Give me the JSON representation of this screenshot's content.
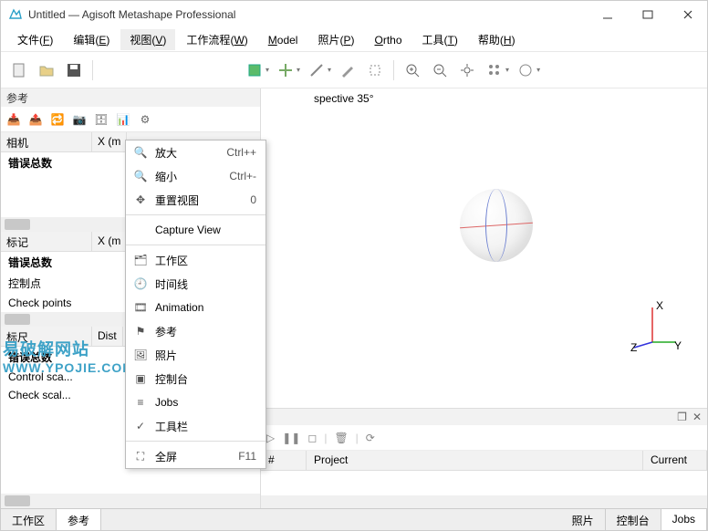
{
  "window": {
    "title": "Untitled — Agisoft Metashape Professional"
  },
  "menubar": {
    "items": [
      {
        "label": "文件",
        "accel": "F"
      },
      {
        "label": "编辑",
        "accel": "E"
      },
      {
        "label": "视图",
        "accel": "V"
      },
      {
        "label": "工作流程",
        "accel": "W"
      },
      {
        "label": "Model",
        "accel": ""
      },
      {
        "label": "照片",
        "accel": "P"
      },
      {
        "label": "Ortho",
        "accel": ""
      },
      {
        "label": "工具",
        "accel": "T"
      },
      {
        "label": "帮助",
        "accel": "H"
      }
    ]
  },
  "view_menu": {
    "items": [
      {
        "icon": "zoom-in-icon",
        "label": "放大",
        "shortcut": "Ctrl++"
      },
      {
        "icon": "zoom-out-icon",
        "label": "缩小",
        "shortcut": "Ctrl+-"
      },
      {
        "icon": "reset-view-icon",
        "label": "重置视图",
        "shortcut": "0"
      },
      {
        "sep": true
      },
      {
        "icon": "",
        "label": "Capture View",
        "shortcut": ""
      },
      {
        "sep": true
      },
      {
        "icon": "workspace-icon",
        "label": "工作区",
        "shortcut": ""
      },
      {
        "icon": "timeline-icon",
        "label": "时间线",
        "shortcut": ""
      },
      {
        "icon": "animation-icon",
        "label": "Animation",
        "shortcut": ""
      },
      {
        "icon": "reference-icon",
        "label": "参考",
        "shortcut": ""
      },
      {
        "icon": "photos-icon",
        "label": "照片",
        "shortcut": ""
      },
      {
        "icon": "console-icon",
        "label": "控制台",
        "shortcut": ""
      },
      {
        "icon": "jobs-icon",
        "label": "Jobs",
        "shortcut": ""
      },
      {
        "icon": "check-icon",
        "label": "工具栏",
        "shortcut": ""
      },
      {
        "sep": true
      },
      {
        "icon": "fullscreen-icon",
        "label": "全屏",
        "shortcut": "F11"
      }
    ]
  },
  "left": {
    "panel1_title": "参考",
    "cameras": {
      "header": "相机",
      "col1": "X (m",
      "err": "错误总数"
    },
    "markers": {
      "header": "标记",
      "col1": "X (m",
      "err": "错误总数",
      "rows": [
        "控制点",
        "Check points"
      ]
    },
    "ruler": {
      "header": "标尺",
      "col1": "Dist",
      "err": "错误总数",
      "rows": [
        "Control sca...",
        "Check scal..."
      ]
    }
  },
  "viewport": {
    "perspective": "spective 35°",
    "axis_x": "X",
    "axis_y": "Y",
    "axis_z": "Z"
  },
  "jobs": {
    "cols": [
      "#",
      "Project",
      "Current"
    ]
  },
  "bottomtabs": {
    "left": [
      "工作区",
      "参考"
    ],
    "right": [
      "照片",
      "控制台",
      "Jobs"
    ]
  },
  "watermark": {
    "line1": "易破解网站",
    "line2": "WWW.YPOJIE.COM"
  }
}
